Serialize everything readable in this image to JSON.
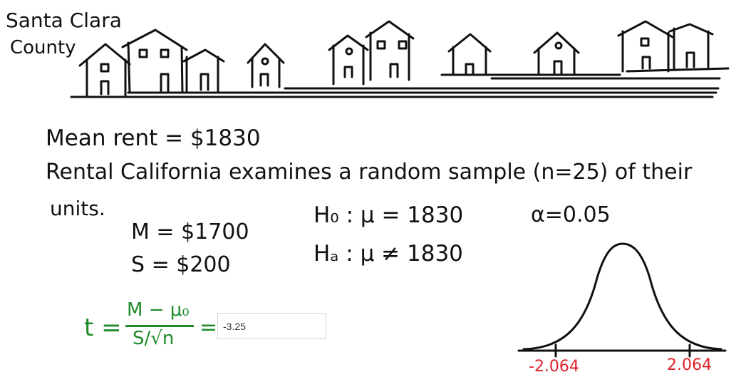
{
  "county": {
    "line1": "Santa Clara",
    "line2": "County"
  },
  "problem": {
    "mean_rent": "Mean rent = $1830",
    "description_line1": "Rental California examines a random sample (n=25) of their",
    "description_line2": "units."
  },
  "sample": {
    "mean": "M = $1700",
    "sd": "S = $200"
  },
  "hypotheses": {
    "null": "H₀ : μ = 1830",
    "alt": "Hₐ : μ ≠ 1830"
  },
  "alpha": "α=0.05",
  "formula": {
    "lhs": "t =",
    "numerator": "M − μ₀",
    "denominator": "S/√n",
    "equals": "="
  },
  "answer": {
    "value": "-3.25"
  },
  "critical": {
    "left": "-2.064",
    "right": "2.064"
  },
  "colors": {
    "ink": "#111111",
    "formula": "#1f8a2a",
    "critical": "#e0202a"
  }
}
